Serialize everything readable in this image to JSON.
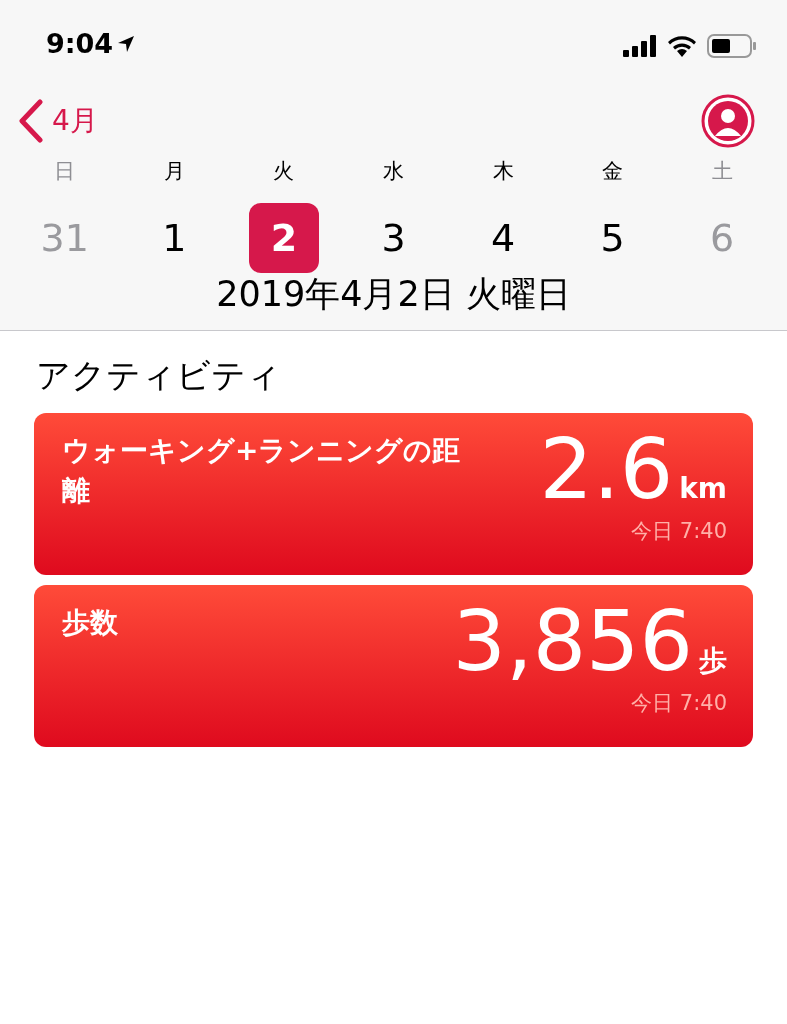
{
  "status_bar": {
    "time": "9:04"
  },
  "header": {
    "back_label": "4月"
  },
  "days": [
    {
      "weekday": "日",
      "date": "31",
      "weekend": true,
      "selected": false
    },
    {
      "weekday": "月",
      "date": "1",
      "weekend": false,
      "selected": false
    },
    {
      "weekday": "火",
      "date": "2",
      "weekend": false,
      "selected": true
    },
    {
      "weekday": "水",
      "date": "3",
      "weekend": false,
      "selected": false
    },
    {
      "weekday": "木",
      "date": "4",
      "weekend": false,
      "selected": false
    },
    {
      "weekday": "金",
      "date": "5",
      "weekend": false,
      "selected": false
    },
    {
      "weekday": "土",
      "date": "6",
      "weekend": true,
      "selected": false
    }
  ],
  "selected_date": "2019年4月2日 火曜日",
  "section_title": "アクティビティ",
  "cards": [
    {
      "title": "ウォーキング+ランニングの距離",
      "value": "2.6",
      "unit": "km",
      "time": "今日 7:40"
    },
    {
      "title": "歩数",
      "value": "3,856",
      "unit": "歩",
      "time": "今日 7:40"
    }
  ]
}
